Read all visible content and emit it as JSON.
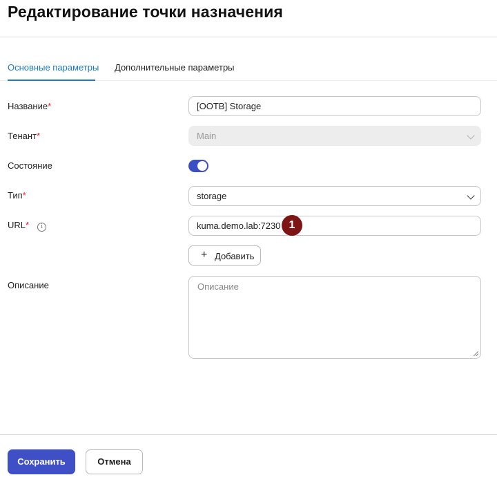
{
  "page": {
    "title": "Редактирование точки назначения"
  },
  "tabs": [
    {
      "label": "Основные параметры",
      "active": true
    },
    {
      "label": "Дополнительные параметры",
      "active": false
    }
  ],
  "fields": {
    "name": {
      "label": "Название",
      "required_mark": "*",
      "value": "[OOTB] Storage"
    },
    "tenant": {
      "label": "Тенант",
      "required_mark": "*",
      "value": "Main",
      "disabled": true
    },
    "state": {
      "label": "Состояние",
      "enabled": true
    },
    "type": {
      "label": "Тип",
      "required_mark": "*",
      "value": "storage"
    },
    "url": {
      "label": "URL",
      "required_mark": "*",
      "info_icon": "i",
      "value": "kuma.demo.lab:7230",
      "add_button": "Добавить",
      "add_icon": "+"
    },
    "description": {
      "label": "Описание",
      "placeholder": "Описание"
    }
  },
  "marker": {
    "number": "1",
    "color": "#7d1515"
  },
  "footer": {
    "save_label": "Сохранить",
    "cancel_label": "Отмена"
  },
  "colors": {
    "accent": "#1f7acc",
    "primary_button": "#3f50c7",
    "toggle_on": "#3b4fc4",
    "required": "#e0262e"
  }
}
